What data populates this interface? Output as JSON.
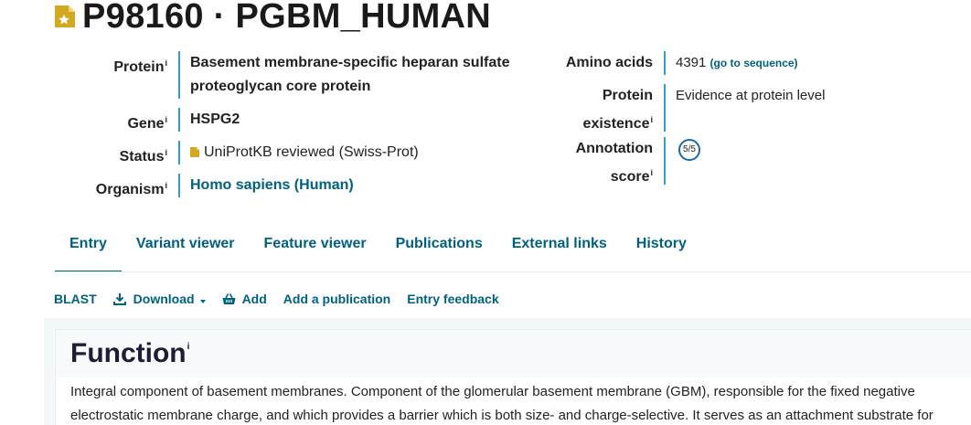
{
  "header": {
    "title": "P98160 · PGBM_HUMAN"
  },
  "info_superscript": "i",
  "left_meta": [
    {
      "label": "Protein",
      "value": "Basement membrane-specific heparan sulfate proteoglycan core protein",
      "style": "bold"
    },
    {
      "label": "Gene",
      "value": "HSPG2",
      "style": "bold"
    },
    {
      "label": "Status",
      "value": "UniProtKB reviewed (Swiss-Prot)",
      "style": "status"
    },
    {
      "label": "Organism",
      "value": "Homo sapiens (Human)",
      "style": "link"
    }
  ],
  "right_meta": {
    "amino_acids": {
      "label": "Amino acids",
      "value": "4391",
      "link": "(go to sequence)"
    },
    "protein_existence": {
      "label_line1": "Protein",
      "label_line2": "existence",
      "value": "Evidence at protein level"
    },
    "annotation_score": {
      "label_line1": "Annotation",
      "label_line2": "score",
      "value": "5/5"
    }
  },
  "tabs": [
    {
      "label": "Entry",
      "active": true
    },
    {
      "label": "Variant viewer",
      "active": false
    },
    {
      "label": "Feature viewer",
      "active": false
    },
    {
      "label": "Publications",
      "active": false
    },
    {
      "label": "External links",
      "active": false
    },
    {
      "label": "History",
      "active": false
    }
  ],
  "toolbar": {
    "blast": "BLAST",
    "download": "Download",
    "add": "Add",
    "add_publication": "Add a publication",
    "entry_feedback": "Entry feedback"
  },
  "function_section": {
    "title": "Function",
    "text": "Integral component of basement membranes. Component of the glomerular basement membrane (GBM), responsible for the fixed negative electrostatic membrane charge, and which provides a barrier which is both size- and charge-selective. It serves as an attachment substrate for"
  },
  "colors": {
    "accent": "#00617f",
    "divider": "#2f9fcf",
    "badge": "#d1a81f"
  }
}
